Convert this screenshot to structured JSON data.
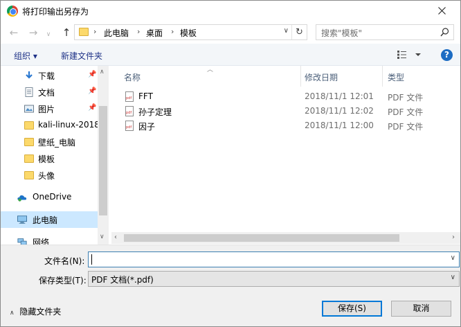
{
  "window": {
    "title": "将打印输出另存为"
  },
  "nav": {
    "breadcrumb": [
      "此电脑",
      "桌面",
      "模板"
    ],
    "search_placeholder": "搜索\"模板\""
  },
  "toolbar": {
    "organize_label": "组织 ▾",
    "new_folder_label": "新建文件夹",
    "help_label": "?"
  },
  "sidebar": {
    "items": [
      {
        "label": "下载",
        "icon": "download-icon",
        "pinned": true
      },
      {
        "label": "文档",
        "icon": "document-icon",
        "pinned": true
      },
      {
        "label": "图片",
        "icon": "picture-icon",
        "pinned": true
      },
      {
        "label": "kali-linux-2018-",
        "icon": "folder-icon",
        "pinned": false
      },
      {
        "label": "壁纸_电脑",
        "icon": "folder-icon",
        "pinned": false
      },
      {
        "label": "模板",
        "icon": "folder-icon",
        "pinned": false
      },
      {
        "label": "头像",
        "icon": "folder-icon",
        "pinned": false
      },
      {
        "label": "OneDrive",
        "icon": "onedrive-icon",
        "pinned": false
      },
      {
        "label": "此电脑",
        "icon": "computer-icon",
        "pinned": false,
        "selected": true
      },
      {
        "label": "网络",
        "icon": "network-icon",
        "pinned": false
      }
    ]
  },
  "filelist": {
    "columns": [
      "名称",
      "修改日期",
      "类型"
    ],
    "rows": [
      {
        "name": "FFT",
        "date": "2018/11/1 12:01",
        "type": "PDF 文件"
      },
      {
        "name": "孙子定理",
        "date": "2018/11/1 12:02",
        "type": "PDF 文件"
      },
      {
        "name": "因子",
        "date": "2018/11/1 12:00",
        "type": "PDF 文件"
      }
    ]
  },
  "form": {
    "filename_label": "文件名(N):",
    "filename_value": "",
    "filetype_label": "保存类型(T):",
    "filetype_value": "PDF 文档(*.pdf)"
  },
  "footer": {
    "hide_folders_label": "隐藏文件夹",
    "save_label": "保存(S)",
    "cancel_label": "取消"
  },
  "colors": {
    "accent": "#0078d7",
    "selection": "#cce8ff",
    "link": "#1e3287"
  }
}
